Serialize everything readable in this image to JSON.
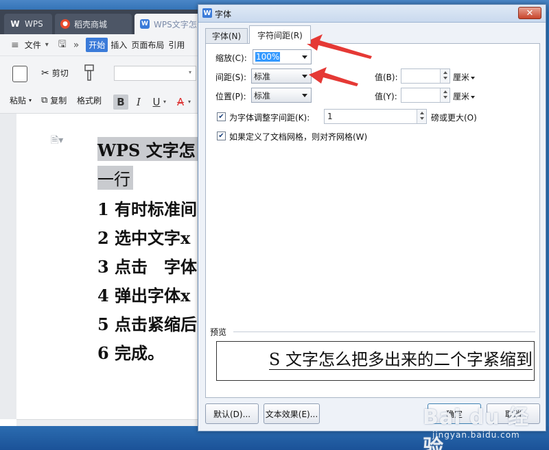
{
  "wps": {
    "tabs": [
      {
        "label": "WPS"
      },
      {
        "label": "稻壳商城"
      },
      {
        "label": "WPS文字怎"
      }
    ],
    "menu": {
      "file": "文件",
      "start": "开始",
      "insert": "插入",
      "layout": "页面布局",
      "reference": "引用"
    },
    "ribbon": {
      "paste": "粘贴",
      "cut": "剪切",
      "copy": "复制",
      "format_painter": "格式刷",
      "bold": "B",
      "italic": "I",
      "underline": "U",
      "font_color": "A"
    },
    "document_lines": [
      "WPS 文字怎",
      "一行",
      "1 有时标准间",
      "2 选中文字x",
      "3 点击　字体",
      "4 弹出字体x",
      "5 点击紧缩后",
      "6 完成。"
    ]
  },
  "dialog": {
    "title": "字体",
    "close": "✕",
    "tabs": {
      "font": "字体(N)",
      "spacing": "字符间距(R)"
    },
    "scale": {
      "label": "缩放(C):",
      "value": "100%"
    },
    "spacing": {
      "label": "间距(S):",
      "value": "",
      "value_label": "值(B):",
      "unit": "厘米"
    },
    "position": {
      "label": "位置(P):",
      "value": "标准",
      "value_label": "值(Y):",
      "unit": "厘米"
    },
    "kerning": {
      "label": "为字体调整字间距(K):",
      "value": "1",
      "suffix": "磅或更大(O)",
      "checked": true
    },
    "grid": {
      "label": "如果定义了文档网格，则对齐网格(W)",
      "checked": true
    },
    "preview": {
      "label": "预览",
      "text": "S 文字怎么把多出来的二个字紧缩到"
    },
    "buttons": {
      "default": "默认(D)...",
      "text_effect": "文本效果(E)...",
      "ok": "确定",
      "cancel": "取消"
    }
  },
  "watermark": {
    "brand": "Bai du 经验",
    "url": "jingyan.baidu.com"
  },
  "colors": {
    "accent": "#3b7bd9",
    "annotation": "#e53935",
    "selection": "#3399ff"
  }
}
